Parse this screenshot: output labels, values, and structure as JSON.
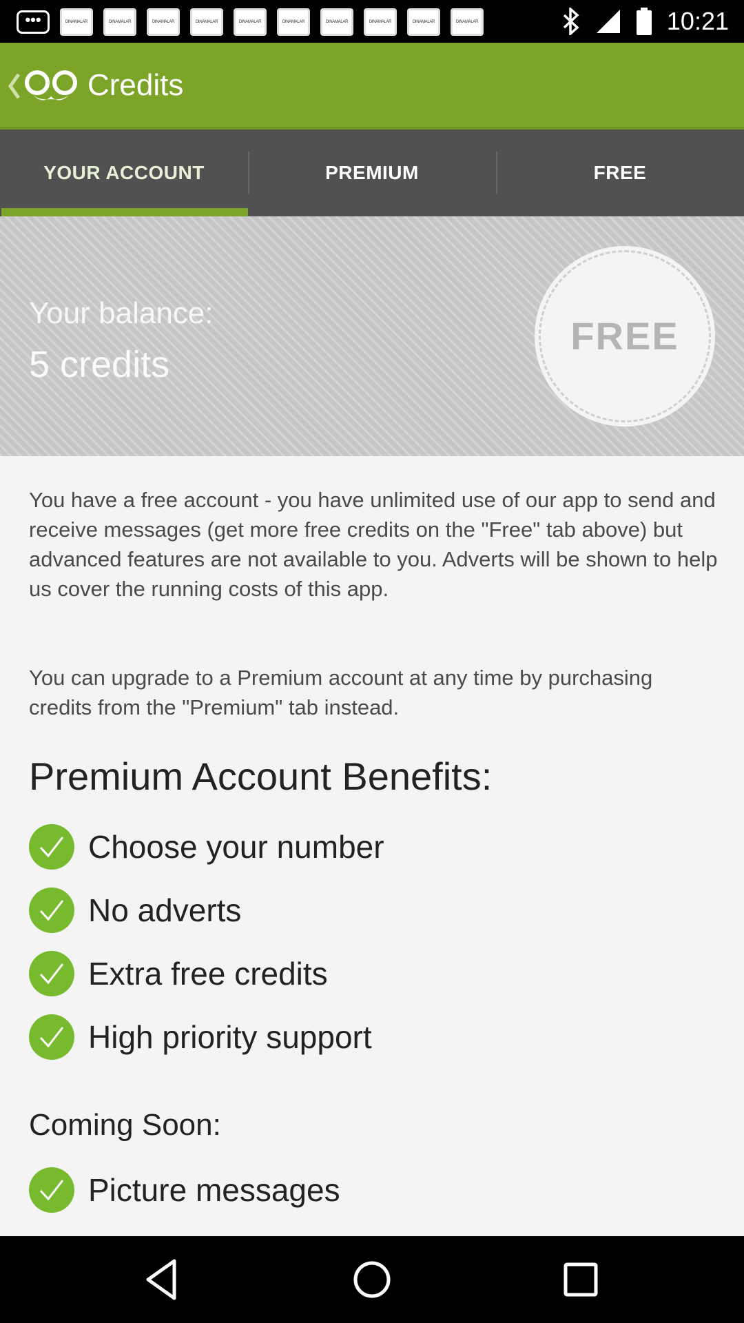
{
  "status_bar": {
    "time": "10:21",
    "notification_label": "DINAMALAR",
    "notification_count": 10,
    "icons": [
      "more-dots-icon",
      "bluetooth-icon",
      "signal-icon",
      "battery-icon"
    ]
  },
  "app_bar": {
    "title": "Credits",
    "icons": [
      "back-icon",
      "app-logo-icon"
    ],
    "color": "#7ba428"
  },
  "tabs": [
    {
      "label": "YOUR ACCOUNT",
      "active": true
    },
    {
      "label": "PREMIUM",
      "active": false
    },
    {
      "label": "FREE",
      "active": false
    }
  ],
  "balance": {
    "label": "Your balance:",
    "value": "5 credits",
    "badge": "FREE"
  },
  "content": {
    "paragraph1": "You have a free account - you have unlimited use of our app to send and receive messages (get more free credits on the \"Free\" tab above) but advanced features are not available to you. Adverts will be shown to help us cover the running costs of this app.",
    "paragraph2": "You can upgrade to a Premium account at any time by purchasing credits from the \"Premium\" tab instead.",
    "benefits_title": "Premium Account Benefits:",
    "benefits": [
      "Choose your number",
      "No adverts",
      "Extra free credits",
      "High priority support"
    ],
    "coming_soon_title": "Coming Soon:",
    "coming_soon": [
      "Picture messages"
    ],
    "check_color": "#78ba2e"
  },
  "nav_bar": {
    "icons": [
      "back-triangle-icon",
      "home-circle-icon",
      "recents-square-icon"
    ]
  }
}
